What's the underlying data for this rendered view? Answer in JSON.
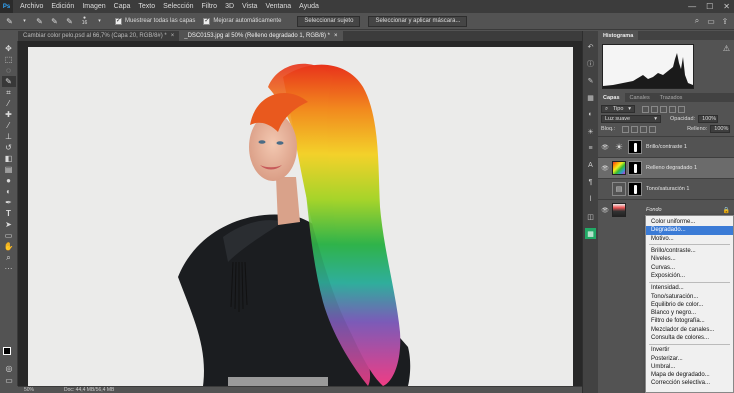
{
  "app": {
    "logo": "Ps"
  },
  "menu": [
    "Archivo",
    "Edición",
    "Imagen",
    "Capa",
    "Texto",
    "Selección",
    "Filtro",
    "3D",
    "Vista",
    "Ventana",
    "Ayuda"
  ],
  "window_controls": {
    "minimize": "—",
    "maximize": "☐",
    "close": "✕"
  },
  "options": {
    "brush_size": "16",
    "sample_all_layers": "Muestrear todas las capas",
    "auto_enhance": "Mejorar automáticamente",
    "select_subject": "Seleccionar sujeto",
    "select_and_mask": "Seleccionar y aplicar máscara..."
  },
  "tabs": [
    {
      "label": "Cambiar color pelo.psd al 66,7% (Capa 20, RGB/8#) *",
      "close": "×"
    },
    {
      "label": "_DSC0153.jpg al 50% (Relleno degradado 1, RGB/8) *",
      "close": "×"
    }
  ],
  "status": {
    "zoom": "50%",
    "doc": "Doc: 44,4 MB/56,4 MB"
  },
  "panels": {
    "histogram_tab": "Histograma",
    "layers_tab": "Capas",
    "channels_tab": "Canales",
    "paths_tab": "Trazados",
    "filter_kind": "Tipo",
    "blend_mode": "Luz suave",
    "opacity_label": "Opacidad:",
    "opacity_value": "100%",
    "lock_label": "Bloq.:",
    "fill_label": "Relleno:",
    "fill_value": "100%"
  },
  "layers": [
    {
      "name": "Brillo/contraste 1",
      "visible": true
    },
    {
      "name": "Relleno degradado 1",
      "visible": true
    },
    {
      "name": "Tono/saturación 1",
      "visible": false
    },
    {
      "name": "Fondo",
      "visible": true
    }
  ],
  "context_menu": [
    "Color uniforme...",
    "Degradado...",
    "Motivo...",
    "Brillo/contraste...",
    "Niveles...",
    "Curvas...",
    "Exposición...",
    "Intensidad...",
    "Tono/saturación...",
    "Equilibrio de color...",
    "Blanco y negro...",
    "Filtro de fotografía...",
    "Mezclador de canales...",
    "Consulta de colores...",
    "Invertir",
    "Posterizar...",
    "Umbral...",
    "Mapa de degradado...",
    "Corrección selectiva..."
  ],
  "colors": {
    "accent": "#3b7bd6",
    "menu_bg": "#3c3c3c",
    "panel_bg": "#535353",
    "canvas_bg": "#ebebea"
  }
}
